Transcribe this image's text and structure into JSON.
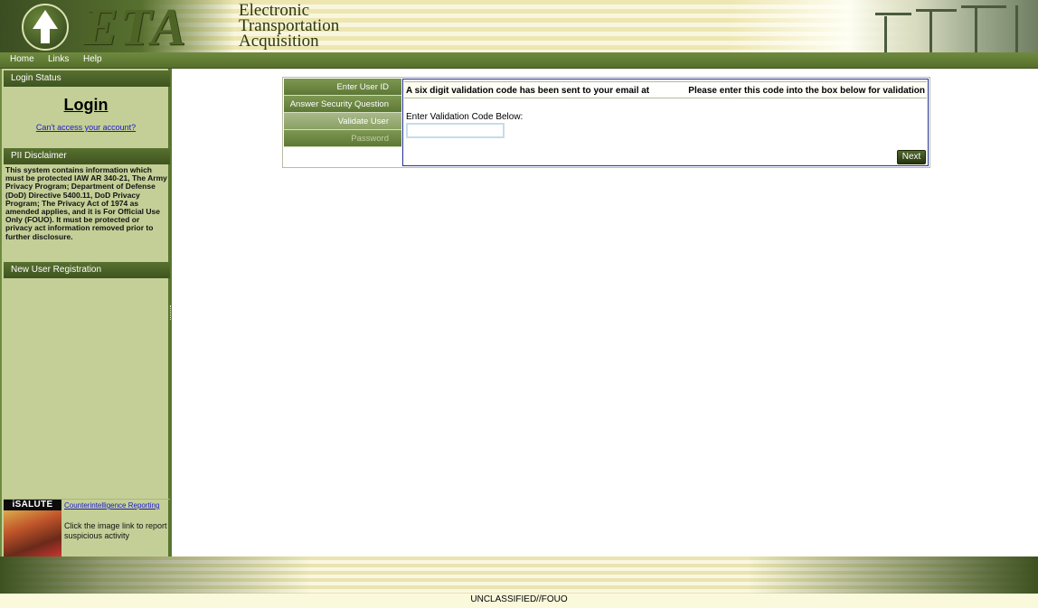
{
  "header": {
    "logo_text": "ETA",
    "title_lines": [
      "Electronic",
      "Transportation",
      "Acquisition"
    ]
  },
  "nav": {
    "items": [
      {
        "label": "Home"
      },
      {
        "label": "Links"
      },
      {
        "label": "Help"
      }
    ]
  },
  "sidebar": {
    "login_status_header": "Login Status",
    "login_link": "Login",
    "cant_access_link": "Can't access your account?",
    "pii_header": "PII Disclaimer",
    "pii_text": "This system contains information which must be protected IAW AR 340-21, The Army Privacy Program; Department of Defense (DoD) Directive 5400.11, DoD Privacy Program; The Privacy Act of 1974 as amended applies, and it is For Official Use Only (FOUO). It must be protected or privacy act information removed prior to further disclosure.",
    "registration_header": "New User Registration",
    "salute": {
      "image_label": "iSALUTE",
      "link": "Counterintelligence Reporting",
      "description": "Click the image link to report suspicious activity"
    }
  },
  "wizard": {
    "steps": [
      {
        "label": "Enter User ID",
        "state": "done"
      },
      {
        "label": "Answer Security Question",
        "state": "done"
      },
      {
        "label": "Validate User",
        "state": "current"
      },
      {
        "label": "Password",
        "state": "disabled"
      }
    ],
    "message_left": "A six digit validation code has been sent to your email at",
    "message_right": "Please enter this code into the box below for validation",
    "code_label": "Enter Validation Code Below:",
    "code_value": "",
    "next_label": "Next"
  },
  "footer": {
    "classification": "UNCLASSIFIED//FOUO"
  },
  "colors": {
    "accent_green": "#57702f",
    "sidebar_bg": "#c4cf97",
    "link_blue": "#1a1acc"
  }
}
